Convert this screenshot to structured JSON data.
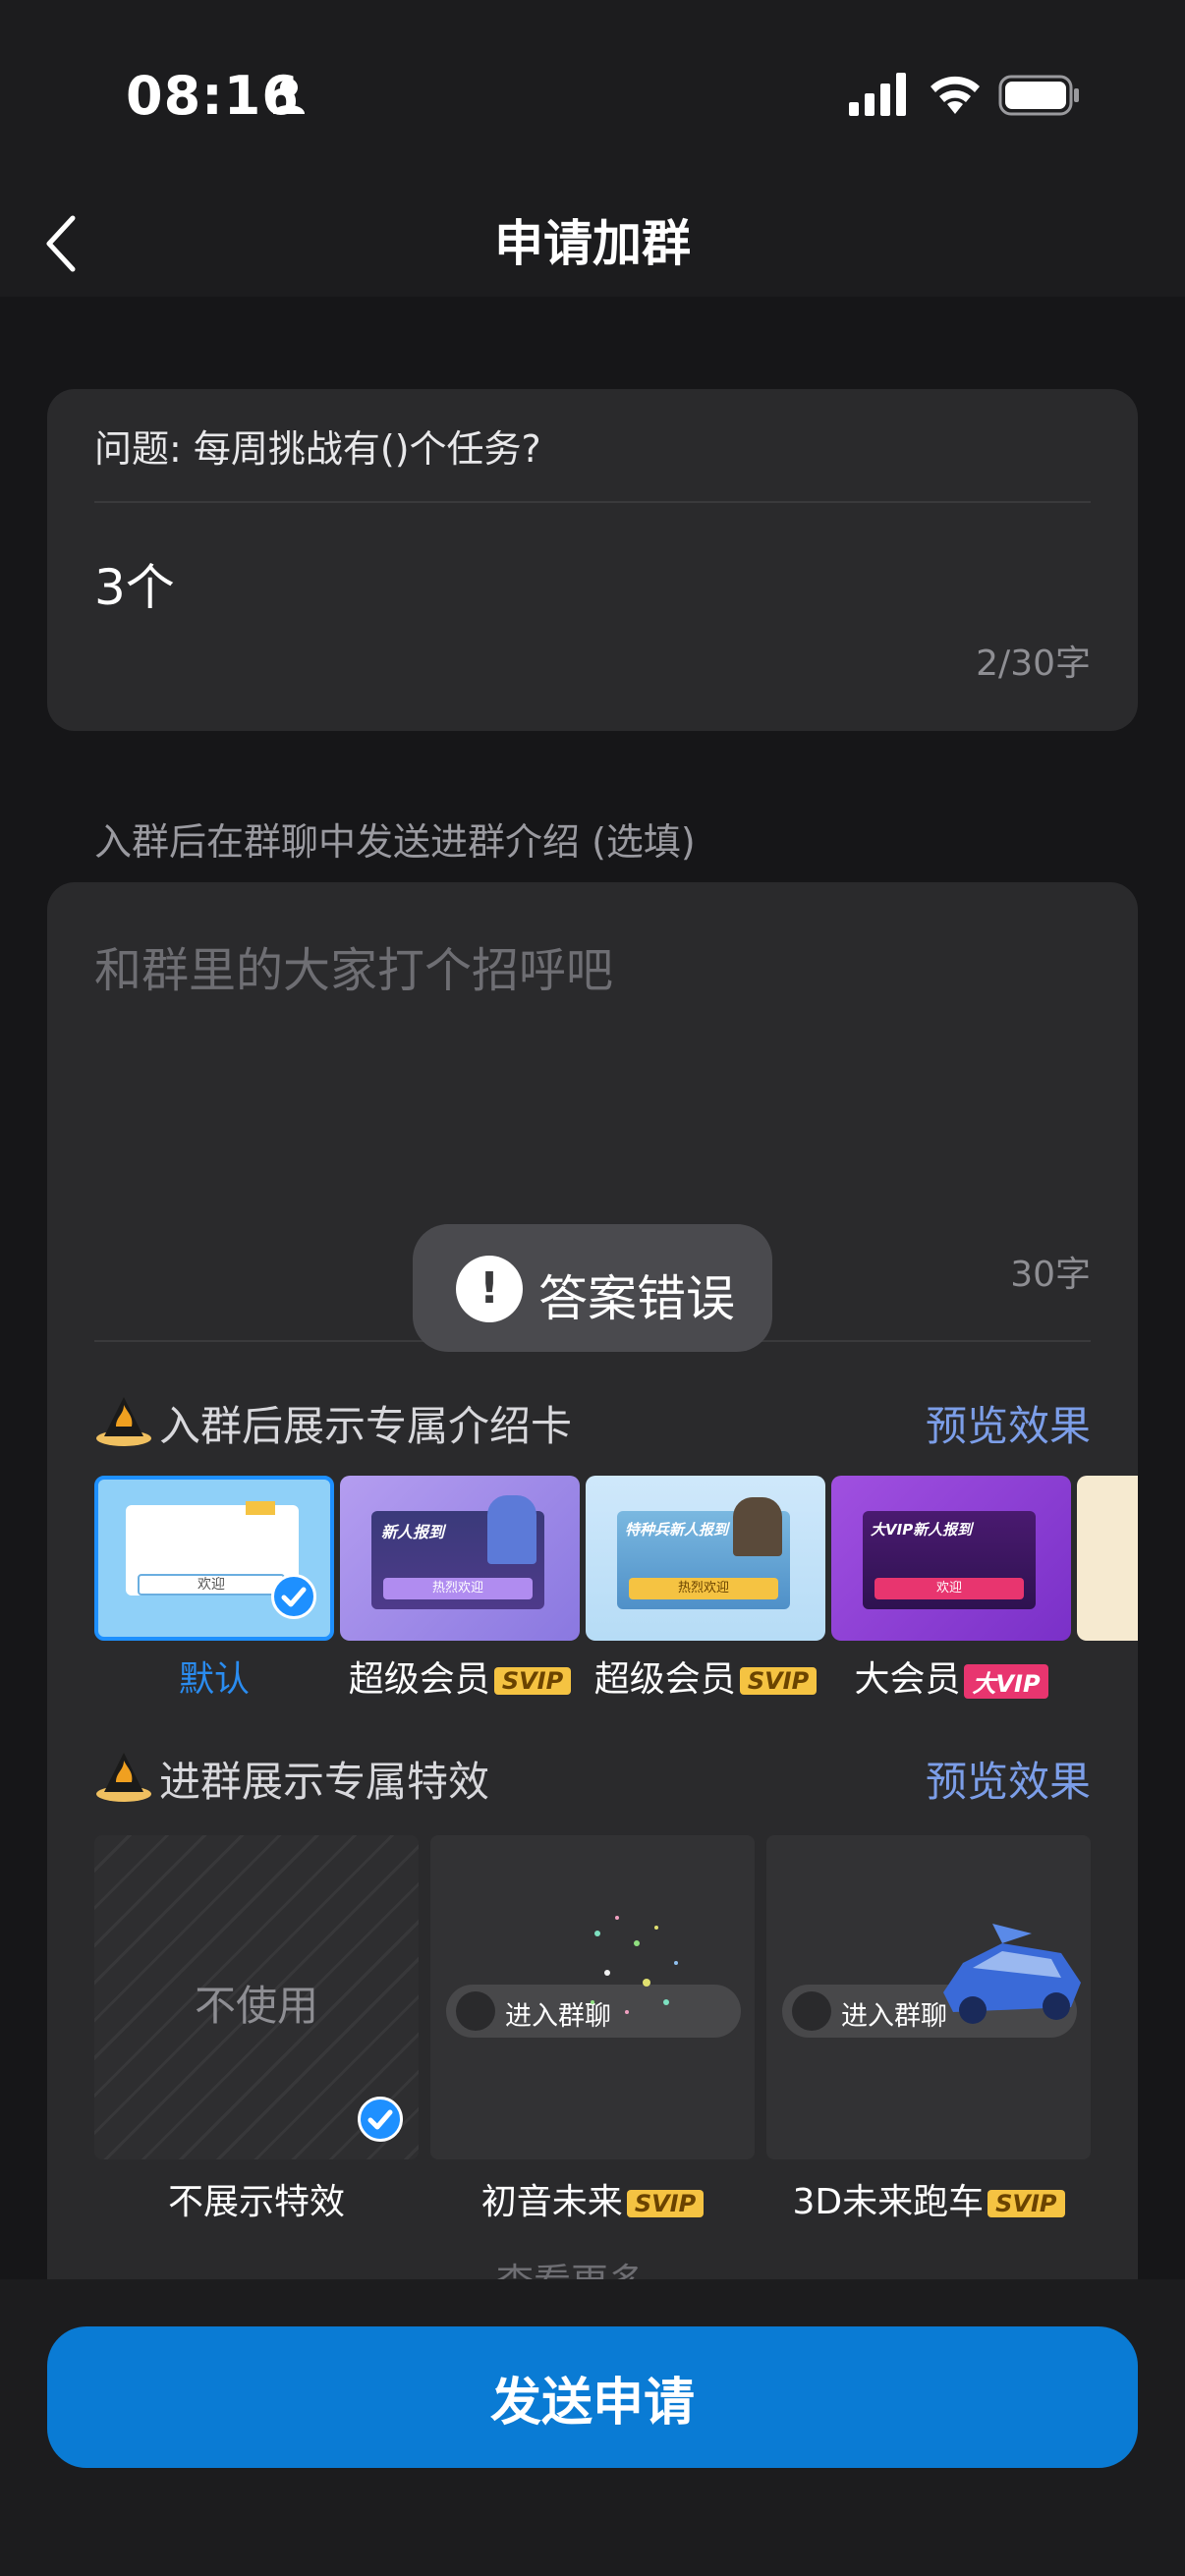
{
  "status_bar": {
    "time": "08:16"
  },
  "nav": {
    "title": "申请加群"
  },
  "qa": {
    "question": "问题: 每周挑战有()个任务?",
    "answer": "3个",
    "counter": "2/30字"
  },
  "intro": {
    "label": "入群后在群聊中发送进群介绍 (选填)",
    "placeholder": "和群里的大家打个招呼吧",
    "counter": "30字"
  },
  "intro_cards": {
    "title": "入群后展示专属介绍卡",
    "preview": "预览效果",
    "items": [
      {
        "label": "默认",
        "badge": "",
        "selected": true,
        "thumb_text": "欢迎"
      },
      {
        "label": "超级会员",
        "badge": "SVIP",
        "selected": false,
        "thumb_title": "新人报到",
        "thumb_btn": "热烈欢迎"
      },
      {
        "label": "超级会员",
        "badge": "SVIP",
        "selected": false,
        "thumb_title": "特种兵新人报到",
        "thumb_btn": "热烈欢迎"
      },
      {
        "label": "大会员",
        "badge": "大VIP",
        "selected": false,
        "thumb_title": "大VIP新人报到",
        "thumb_btn": "欢迎"
      }
    ]
  },
  "effects": {
    "title": "进群展示专属特效",
    "preview": "预览效果",
    "items": [
      {
        "label": "不展示特效",
        "badge": "",
        "selected": true,
        "thumb_text": "不使用"
      },
      {
        "label": "初音未来",
        "badge": "SVIP",
        "selected": false,
        "pill_text": "进入群聊"
      },
      {
        "label": "3D未来跑车",
        "badge": "SVIP",
        "selected": false,
        "pill_text": "进入群聊"
      }
    ]
  },
  "more": {
    "label": "查看更多"
  },
  "toast": {
    "text": "答案错误",
    "icon": "exclamation-icon"
  },
  "submit": {
    "label": "发送申请"
  },
  "colors": {
    "accent": "#0a7bd4",
    "link": "#7c9ee8",
    "selected": "#2a8cf0",
    "svip_badge": "#f5c342",
    "vip_badge": "#e8356f"
  }
}
